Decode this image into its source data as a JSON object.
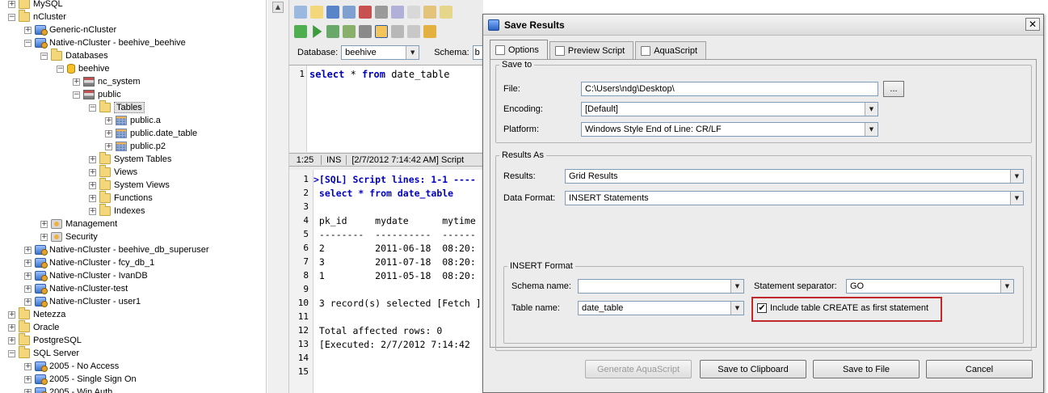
{
  "tree": {
    "items": [
      {
        "label": "MySQL",
        "exp": "+",
        "icon": "folder",
        "indent": 0
      },
      {
        "label": "nCluster",
        "exp": "−",
        "icon": "folder",
        "indent": 0
      },
      {
        "label": "Generic-nCluster",
        "exp": "+",
        "icon": "server",
        "indent": 1
      },
      {
        "label": "Native-nCluster - beehive_beehive",
        "exp": "−",
        "icon": "server",
        "indent": 1
      },
      {
        "label": "Databases",
        "exp": "−",
        "icon": "folder",
        "indent": 2
      },
      {
        "label": "beehive",
        "exp": "−",
        "icon": "db",
        "indent": 3
      },
      {
        "label": "nc_system",
        "exp": "+",
        "icon": "schema",
        "indent": 4
      },
      {
        "label": "public",
        "exp": "−",
        "icon": "schema",
        "indent": 4
      },
      {
        "label": "Tables",
        "exp": "−",
        "icon": "folder",
        "indent": 5,
        "selected": true
      },
      {
        "label": "public.a",
        "exp": "+",
        "icon": "table",
        "indent": 6
      },
      {
        "label": "public.date_table",
        "exp": "+",
        "icon": "table",
        "indent": 6
      },
      {
        "label": "public.p2",
        "exp": "+",
        "icon": "table",
        "indent": 6
      },
      {
        "label": "System Tables",
        "exp": "+",
        "icon": "folder",
        "indent": 5
      },
      {
        "label": "Views",
        "exp": "+",
        "icon": "folder",
        "indent": 5
      },
      {
        "label": "System Views",
        "exp": "+",
        "icon": "folder",
        "indent": 5
      },
      {
        "label": "Functions",
        "exp": "+",
        "icon": "folder",
        "indent": 5
      },
      {
        "label": "Indexes",
        "exp": "+",
        "icon": "folder",
        "indent": 5
      },
      {
        "label": "Management",
        "exp": "+",
        "icon": "mgmt",
        "indent": 2
      },
      {
        "label": "Security",
        "exp": "+",
        "icon": "mgmt",
        "indent": 2
      },
      {
        "label": "Native-nCluster - beehive_db_superuser",
        "exp": "+",
        "icon": "server",
        "indent": 1
      },
      {
        "label": "Native-nCluster - fcy_db_1",
        "exp": "+",
        "icon": "server",
        "indent": 1
      },
      {
        "label": "Native-nCluster - IvanDB",
        "exp": "+",
        "icon": "server",
        "indent": 1
      },
      {
        "label": "Native-nCluster-test",
        "exp": "+",
        "icon": "server",
        "indent": 1
      },
      {
        "label": "Native-nCluster - user1",
        "exp": "+",
        "icon": "server",
        "indent": 1
      },
      {
        "label": "Netezza",
        "exp": "+",
        "icon": "folder",
        "indent": 0
      },
      {
        "label": "Oracle",
        "exp": "+",
        "icon": "folder",
        "indent": 0
      },
      {
        "label": "PostgreSQL",
        "exp": "+",
        "icon": "folder",
        "indent": 0
      },
      {
        "label": "SQL Server",
        "exp": "−",
        "icon": "folder",
        "indent": 0
      },
      {
        "label": "2005 - No Access",
        "exp": "+",
        "icon": "server",
        "indent": 1
      },
      {
        "label": "2005 - Single Sign On",
        "exp": "+",
        "icon": "server",
        "indent": 1
      },
      {
        "label": "2005 - Win Auth",
        "exp": "+",
        "icon": "server",
        "indent": 1
      }
    ]
  },
  "editor": {
    "database_label": "Database:",
    "database_value": "beehive",
    "schema_label": "Schema:",
    "schema_value": "b",
    "sql_line_number": "1",
    "sql_text": "from date_table",
    "sql_kw1": "select",
    "sql_star": " * ",
    "sql_kw2": "from",
    "status": {
      "pos": "1:25",
      "mode": "INS",
      "time": "[2/7/2012 7:14:42 AM] Script"
    },
    "output": [
      {
        "n": "1",
        "text": ">[SQL] Script lines: 1-1 ----",
        "style": "kw"
      },
      {
        "n": "2",
        "text": " select * from date_table",
        "style": "kw"
      },
      {
        "n": "3",
        "text": "",
        "style": ""
      },
      {
        "n": "4",
        "text": " pk_id     mydate      mytime",
        "style": ""
      },
      {
        "n": "5",
        "text": " --------  ----------  ------",
        "style": ""
      },
      {
        "n": "6",
        "text": " 2         2011-06-18  08:20:",
        "style": ""
      },
      {
        "n": "7",
        "text": " 3         2011-07-18  08:20:",
        "style": ""
      },
      {
        "n": "8",
        "text": " 1         2011-05-18  08:20:",
        "style": ""
      },
      {
        "n": "9",
        "text": "",
        "style": ""
      },
      {
        "n": "10",
        "text": " 3 record(s) selected [Fetch ]",
        "style": ""
      },
      {
        "n": "11",
        "text": "",
        "style": ""
      },
      {
        "n": "12",
        "text": " Total affected rows: 0",
        "style": ""
      },
      {
        "n": "13",
        "text": " [Executed: 2/7/2012 7:14:42 ",
        "style": ""
      },
      {
        "n": "14",
        "text": "",
        "style": ""
      },
      {
        "n": "15",
        "text": "",
        "style": ""
      }
    ]
  },
  "dialog": {
    "title": "Save Results",
    "close_label": "✕",
    "tabs": [
      {
        "label": "Options",
        "active": true
      },
      {
        "label": "Preview Script",
        "active": false
      },
      {
        "label": "AquaScript",
        "active": false
      }
    ],
    "save_to": {
      "legend": "Save to",
      "file_label": "File:",
      "file_value": "C:\\Users\\ndg\\Desktop\\",
      "browse_label": "...",
      "encoding_label": "Encoding:",
      "encoding_value": "[Default]",
      "platform_label": "Platform:",
      "platform_value": "Windows Style End of Line: CR/LF"
    },
    "results_as": {
      "legend": "Results As",
      "results_label": "Results:",
      "results_value": "Grid Results",
      "format_label": "Data Format:",
      "format_value": "INSERT Statements"
    },
    "insert_format": {
      "legend": "INSERT Format",
      "schema_label": "Schema name:",
      "schema_value": "",
      "separator_label": "Statement separator:",
      "separator_value": "GO",
      "table_label": "Table name:",
      "table_value": "date_table",
      "create_label": "Include table CREATE as first statement",
      "create_checked": "✔"
    },
    "buttons": {
      "generate": "Generate AquaScript",
      "clipboard": "Save to Clipboard",
      "file": "Save to File",
      "cancel": "Cancel"
    },
    "highlight_color": "#c0282b"
  }
}
